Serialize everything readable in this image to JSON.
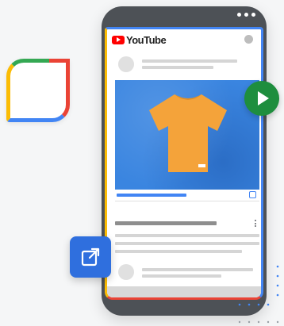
{
  "brand": {
    "name": "YouTube",
    "colors": {
      "red": "#ea4335",
      "green": "#34a853",
      "yellow": "#fbbc05",
      "blue": "#4285f4",
      "youtube_red": "#ff0000",
      "shirt": "#f4a33a"
    }
  },
  "icons": {
    "menu": "more-horiz-icon",
    "play": "play-icon",
    "external": "open-in-new-icon",
    "kebab": "more-vert-icon",
    "product": "tshirt-icon"
  }
}
